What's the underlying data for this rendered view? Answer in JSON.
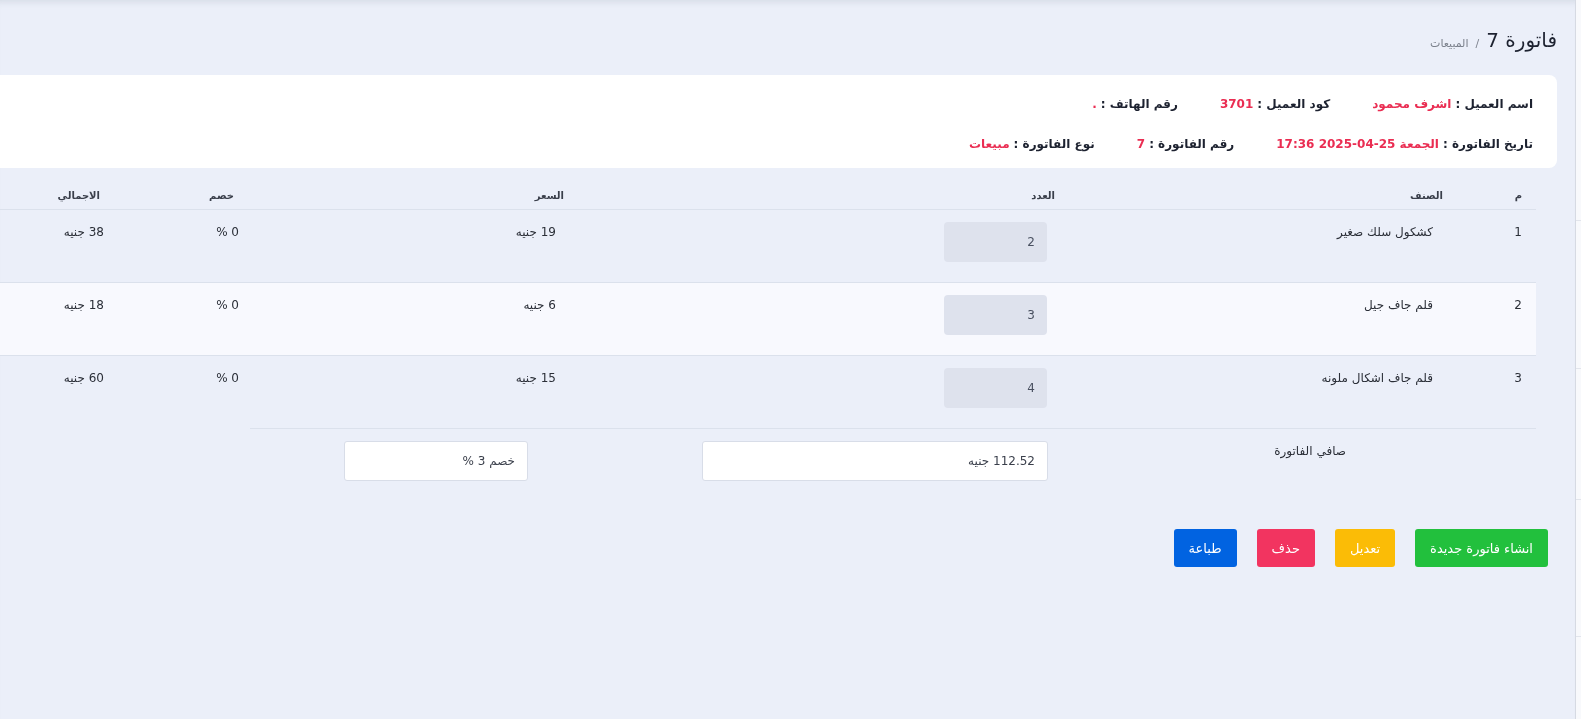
{
  "header": {
    "title": "فاتورة 7",
    "separator": "/",
    "breadcrumb": "المبيعات"
  },
  "info_rows": [
    {
      "fields": [
        {
          "label": "اسم العميل :",
          "value": "اشرف محمود"
        },
        {
          "label": "كود العميل :",
          "value": "3701"
        },
        {
          "label": "رقم الهاتف :",
          "value": "."
        }
      ]
    },
    {
      "fields": [
        {
          "label": "تاريخ الفاتورة :",
          "value": "الجمعة 25-04-2025 17:36"
        },
        {
          "label": "رقم الفاتورة :",
          "value": "7"
        },
        {
          "label": "نوع الفاتورة :",
          "value": "مبيعات"
        }
      ]
    }
  ],
  "table": {
    "columns": [
      "م",
      "الصنف",
      "العدد",
      "السعر",
      "خصم",
      "الاجمالي"
    ],
    "rows": [
      {
        "number": "1",
        "item": "كشكول سلك صغير",
        "quantity": "2",
        "price": "19 جنيه",
        "discount": "0 %",
        "total": "38 جنيه",
        "highlighted": false
      },
      {
        "number": "2",
        "item": "قلم جاف جيل",
        "quantity": "3",
        "price": "6 جنيه",
        "discount": "0 %",
        "total": "18 جنيه",
        "highlighted": true
      },
      {
        "number": "3",
        "item": "قلم جاف اشكال ملونه",
        "quantity": "4",
        "price": "15 جنيه",
        "discount": "0 %",
        "total": "60 جنيه",
        "highlighted": false
      }
    ]
  },
  "totals": {
    "label": "صافي الفاتورة",
    "net_total": "112.52 جنيه",
    "discount": "خصم 3 %"
  },
  "actions": [
    {
      "label": "انشاء فاتورة جديدة",
      "kind": "success"
    },
    {
      "label": "تعديل",
      "kind": "warning"
    },
    {
      "label": "حذف",
      "kind": "danger"
    },
    {
      "label": "طباعة",
      "kind": "primary"
    }
  ]
}
